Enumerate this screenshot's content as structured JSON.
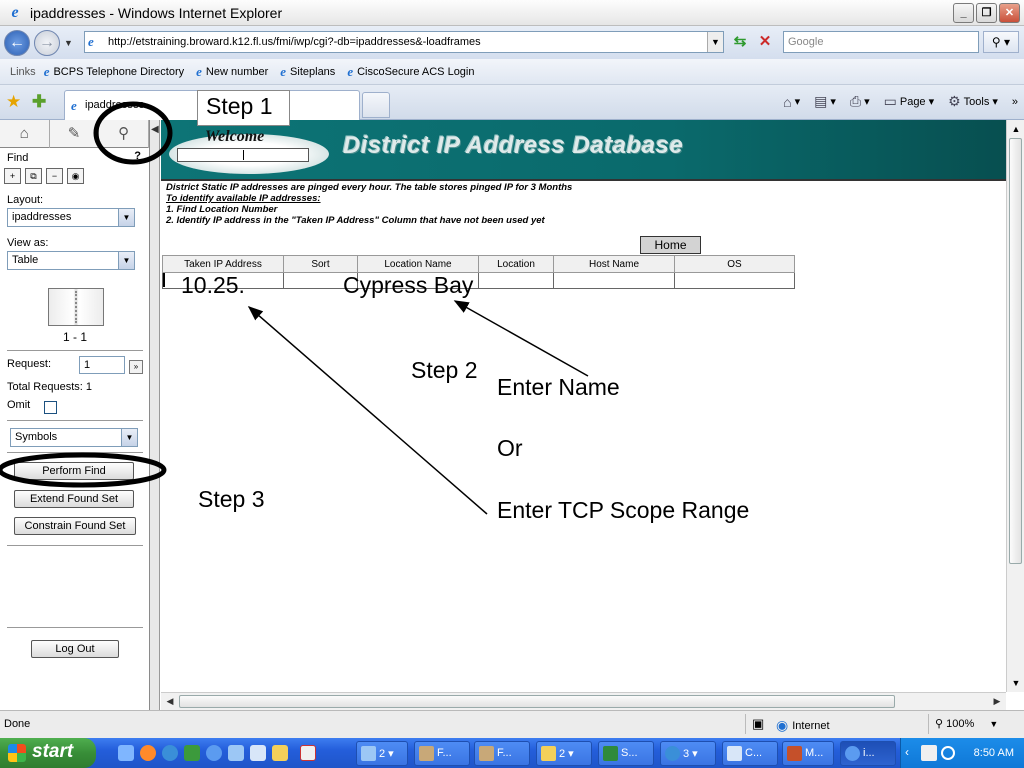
{
  "window": {
    "title": "ipaddresses - Windows Internet Explorer"
  },
  "address_bar": {
    "url": "http://etstraining.broward.k12.fl.us/fmi/iwp/cgi?-db=ipaddresses&-loadframes",
    "search_placeholder": "Google"
  },
  "links_bar": {
    "label": "Links",
    "items": [
      {
        "label": "BCPS Telephone Directory"
      },
      {
        "label": "New number"
      },
      {
        "label": "Siteplans"
      },
      {
        "label": "CiscoSecure ACS Login"
      }
    ]
  },
  "tabs": {
    "active_label": "ipaddresses"
  },
  "command_bar": {
    "page_label": "Page",
    "tools_label": "Tools"
  },
  "left_panel": {
    "mode_label": "Find",
    "layout_label": "Layout:",
    "layout_value": "ipaddresses",
    "view_label": "View as:",
    "view_value": "Table",
    "record_counter": "1 - 1",
    "request_label": "Request:",
    "request_value": "1",
    "total_requests": "Total Requests: 1",
    "omit_label": "Omit",
    "symbols_value": "Symbols",
    "perform_find": "Perform Find",
    "extend_found_set": "Extend Found Set",
    "constrain_found_set": "Constrain Found Set",
    "log_out": "Log Out"
  },
  "banner": {
    "welcome": "Welcome",
    "title": "District IP Address Database"
  },
  "info": {
    "line1": "District Static IP addresses are pinged every hour. The table stores pinged IP for 3 Months",
    "line2": "To identify available IP addresses:",
    "line3": "1. Find Location Number",
    "line4": "2. Identify IP address in the \"Taken IP Address\" Column that have not been used yet"
  },
  "home_button": "Home",
  "table": {
    "columns": [
      "Taken IP Address",
      "Sort",
      "Location Name",
      "Location",
      "Host Name",
      "OS"
    ],
    "find_values": {
      "taken_ip": "10.25.",
      "location_name": "Cypress Bay"
    }
  },
  "annotations": {
    "step1": "Step 1",
    "step2": "Step 2",
    "step3": "Step 3",
    "enter_name": "Enter Name",
    "or": "Or",
    "enter_tcp": "Enter TCP Scope Range"
  },
  "status_bar": {
    "status": "Done",
    "zone": "Internet",
    "zoom": "100%"
  },
  "taskbar": {
    "start_label": "start",
    "buttons": [
      {
        "label": "2"
      },
      {
        "label": "F..."
      },
      {
        "label": "F..."
      },
      {
        "label": "2"
      },
      {
        "label": "S..."
      },
      {
        "label": "3"
      },
      {
        "label": "C..."
      },
      {
        "label": "M..."
      },
      {
        "label": "i..."
      }
    ],
    "clock": "8:50 AM"
  },
  "colors": {
    "banner_teal": "#0d7476",
    "taskbar_blue": "#245edb",
    "start_green": "#388e38"
  }
}
